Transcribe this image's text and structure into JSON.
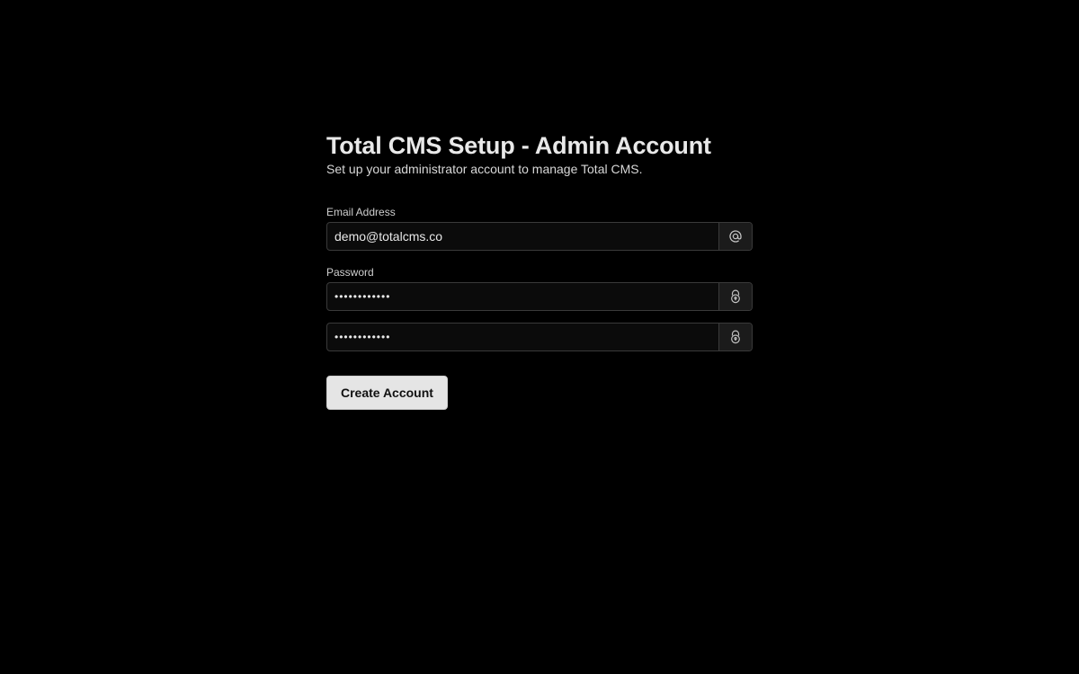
{
  "page": {
    "title": "Total CMS Setup - Admin Account",
    "subtitle": "Set up your administrator account to manage Total CMS."
  },
  "form": {
    "email": {
      "label": "Email Address",
      "value": "demo@totalcms.co",
      "icon": "at-icon"
    },
    "password": {
      "label": "Password",
      "value": "••••••••••••",
      "icon": "lock-icon"
    },
    "confirm_password": {
      "value": "••••••••••••",
      "icon": "lock-icon"
    },
    "submit_label": "Create Account"
  },
  "colors": {
    "background": "#000000",
    "button_bg": "#e5e5e5",
    "input_border": "#3a3a3a"
  }
}
